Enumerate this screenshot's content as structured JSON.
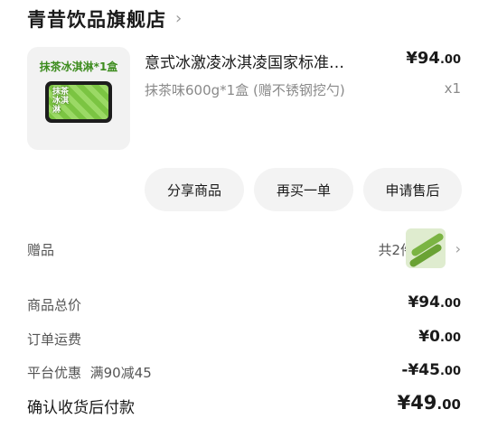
{
  "store": {
    "name": "青昔饮品旗舰店",
    "chevron": "›"
  },
  "product": {
    "image_caption": "抹茶冰淇淋*1盒",
    "image_tub_text": "抹茶冰淇淋",
    "title": "意式冰激凌冰淇凌国家标准…",
    "price_currency": "¥",
    "price_int": "94",
    "price_dec": ".00",
    "variant": "抹茶味600g*1盒 (赠不锈钢挖勺)",
    "qty": "x1"
  },
  "actions": {
    "share": "分享商品",
    "rebuy": "再买一单",
    "aftersale": "申请售后"
  },
  "gift": {
    "label": "赠品",
    "count": "共2件",
    "chevron": "›"
  },
  "summary": {
    "subtotal": {
      "label": "商品总价",
      "currency": "¥",
      "int": "94",
      "dec": ".00"
    },
    "shipping": {
      "label": "订单运费",
      "currency": "¥",
      "int": "0",
      "dec": ".00"
    },
    "discount": {
      "label": "平台优惠",
      "tag": "满90减45",
      "currency": "-¥",
      "int": "45",
      "dec": ".00"
    },
    "total": {
      "label": "确认收货后付款",
      "currency": "¥",
      "int": "49",
      "dec": ".00"
    }
  }
}
